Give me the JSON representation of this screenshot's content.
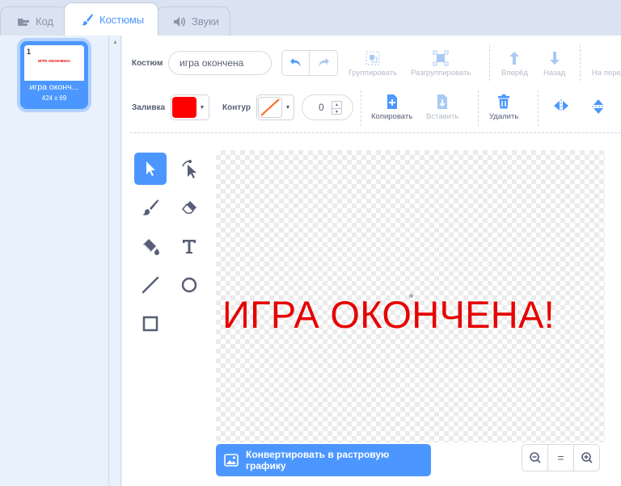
{
  "tabs": [
    {
      "label": "Код",
      "icon": "code-icon"
    },
    {
      "label": "Костюмы",
      "icon": "brush-icon"
    },
    {
      "label": "Звуки",
      "icon": "speaker-icon"
    }
  ],
  "costume_list": {
    "items": [
      {
        "number": "1",
        "name": "игра оконч...",
        "size": "424 x 69",
        "preview_text": "ИГРА ОКОНЧЕНА!"
      }
    ]
  },
  "toolbar": {
    "costume_label": "Костюм",
    "costume_name": "игра окончена",
    "group": "Группировать",
    "ungroup": "Разгруппировать",
    "forward": "Вперёд",
    "backward": "Назад",
    "front": "На перед",
    "fill_label": "Заливка",
    "fill_color": "#ff0000",
    "outline_label": "Контур",
    "outline_width": "0",
    "copy": "Копировать",
    "paste": "Вставить",
    "delete": "Удалить"
  },
  "tools": [
    "select",
    "reshape",
    "brush",
    "eraser",
    "fill",
    "text",
    "line",
    "circle",
    "rectangle"
  ],
  "canvas": {
    "text": "ИГРА ОКОНЧЕНА!",
    "text_color": "#e60000"
  },
  "convert_button": "Конвертировать в растровую графику",
  "zoom": {
    "out": "−",
    "reset": "=",
    "in": "+"
  },
  "colors": {
    "accent": "#4c97ff",
    "text": "#575e75"
  }
}
